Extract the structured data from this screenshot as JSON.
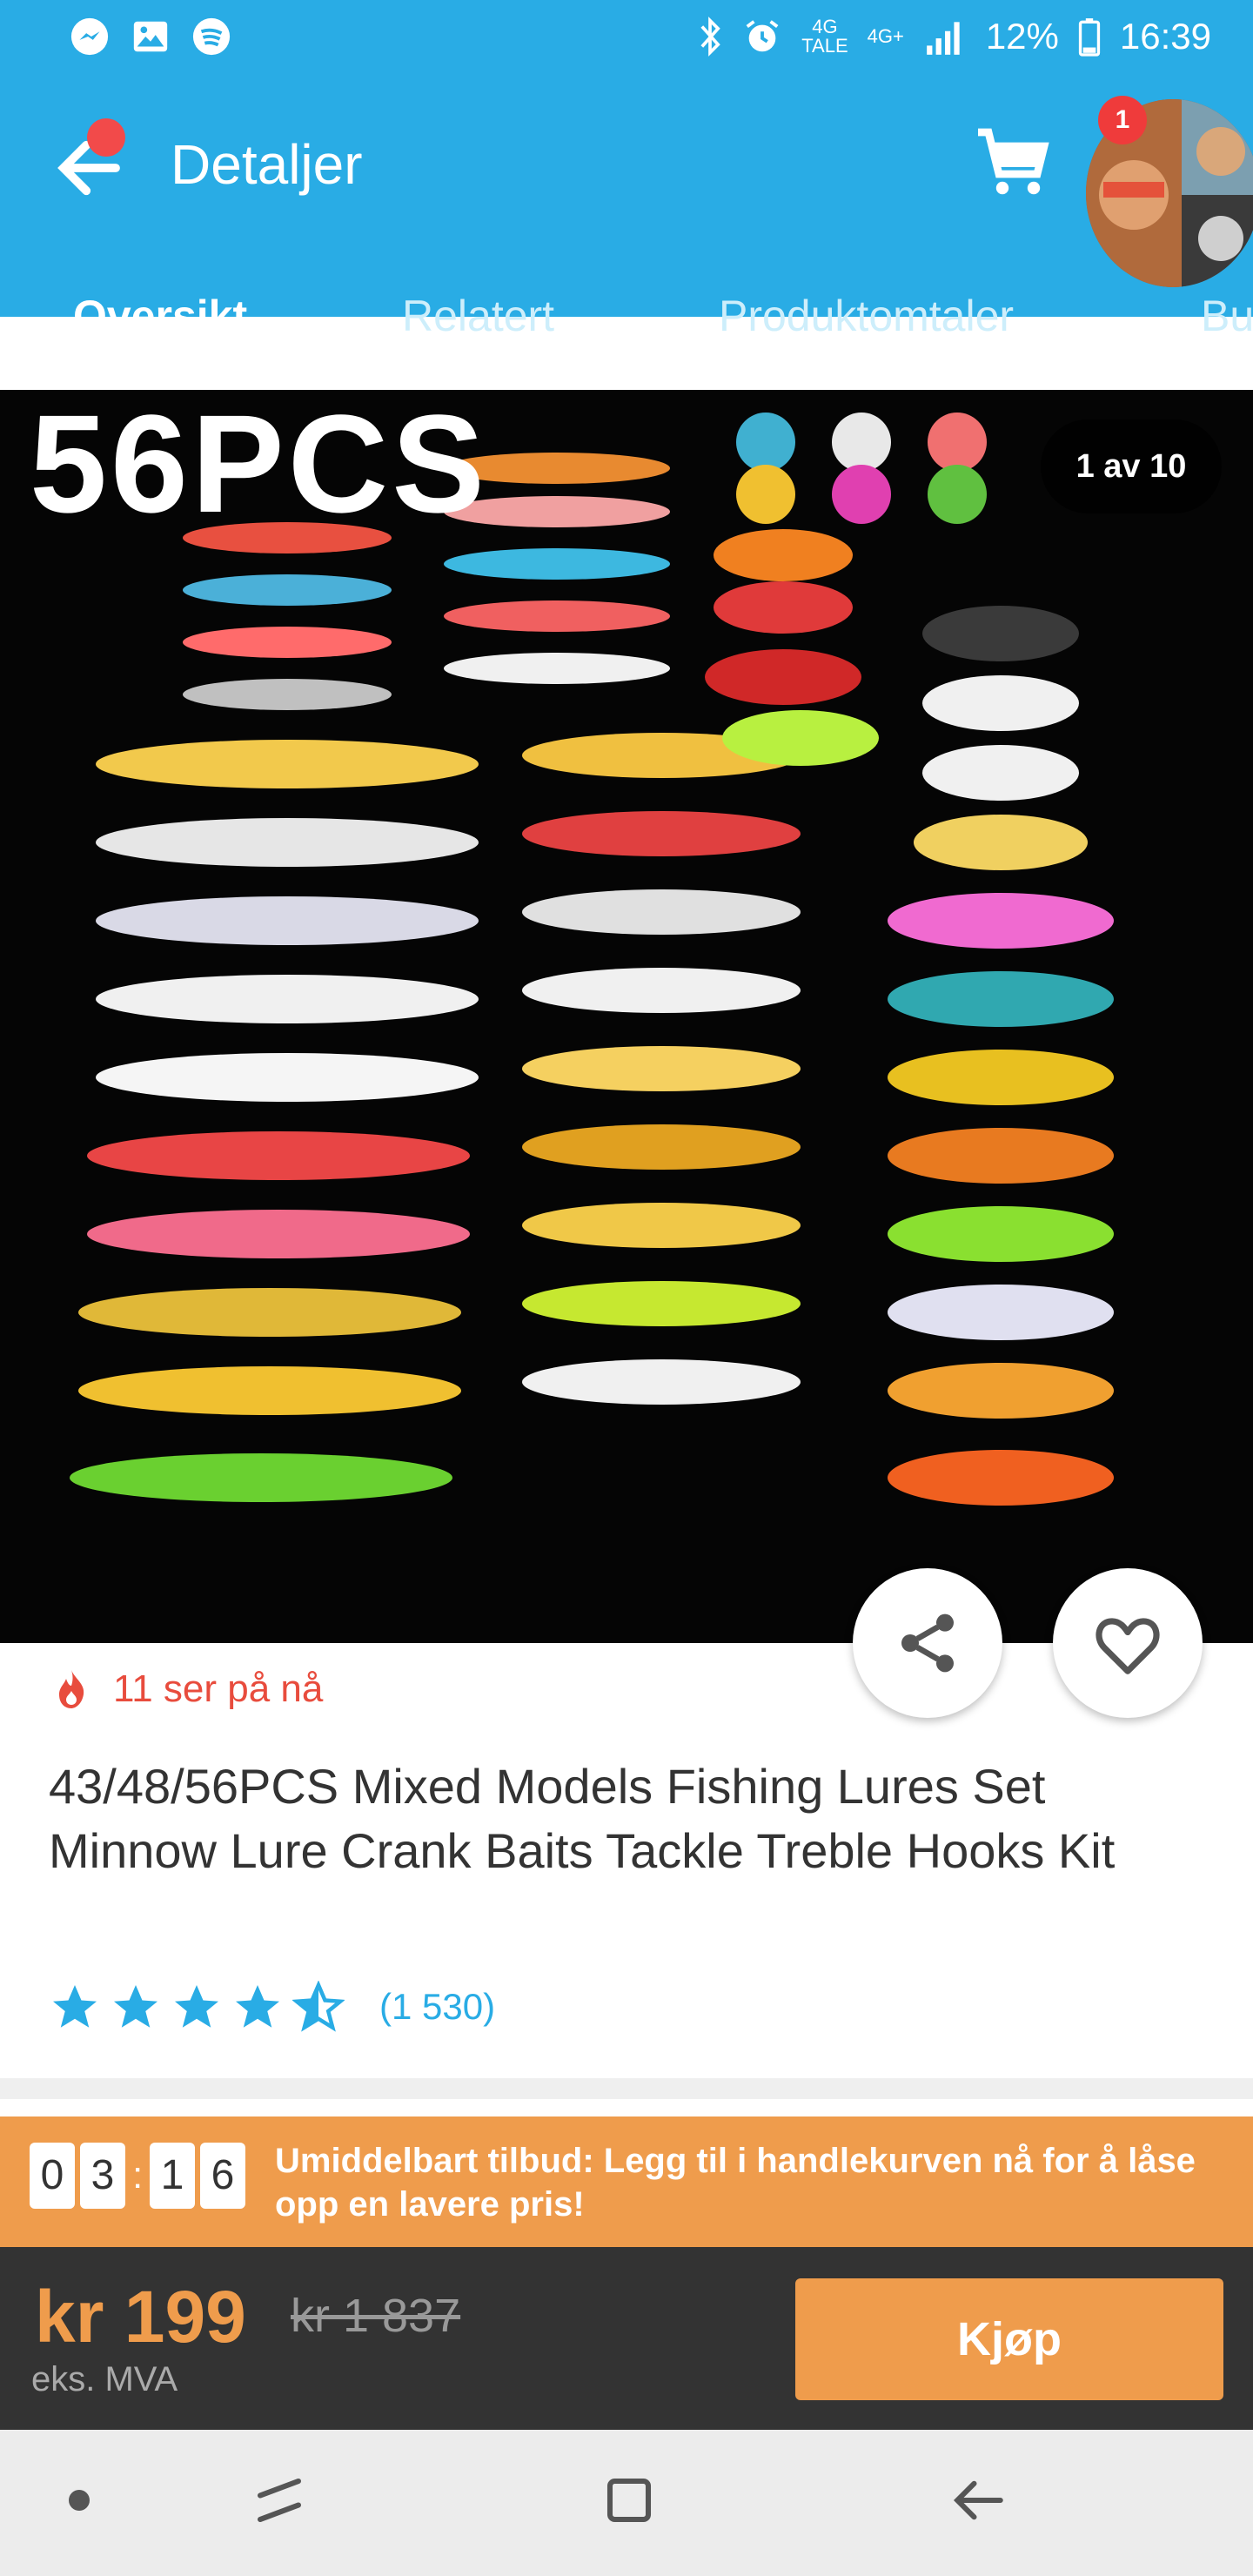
{
  "status_bar": {
    "network_top": "4G",
    "network_bottom": "TALE",
    "network2": "4G+",
    "battery": "12%",
    "time": "16:39"
  },
  "app_bar": {
    "title": "Detaljer",
    "cart_badge": "1"
  },
  "tabs": [
    {
      "label": "Oversikt",
      "active": true
    },
    {
      "label": "Relatert",
      "active": false
    },
    {
      "label": "Produktomtaler",
      "active": false
    },
    {
      "label": "Bu",
      "active": false
    }
  ],
  "gallery": {
    "overlay_text": "56PCS",
    "counter": "1 av 10"
  },
  "product": {
    "watchers": "11 ser på nå",
    "title": "43/48/56PCS Mixed Models Fishing Lures Set Minnow Lure Crank Baits Tackle Treble Hooks Kit",
    "rating": 4.5,
    "reviews": "(1 530)"
  },
  "offer": {
    "timer": [
      "0",
      "3",
      "1",
      "6"
    ],
    "text": "Umiddelbart tilbud: Legg til i handlekurven nå for å låse opp en lavere pris!"
  },
  "price_bar": {
    "price": "kr 199",
    "old_price": "kr 1 837",
    "vat": "eks. MVA",
    "buy_label": "Kjøp"
  },
  "colors": {
    "primary": "#29ace5",
    "accent": "#ef9c4c",
    "alert": "#e84c3d",
    "dark": "#333333"
  }
}
